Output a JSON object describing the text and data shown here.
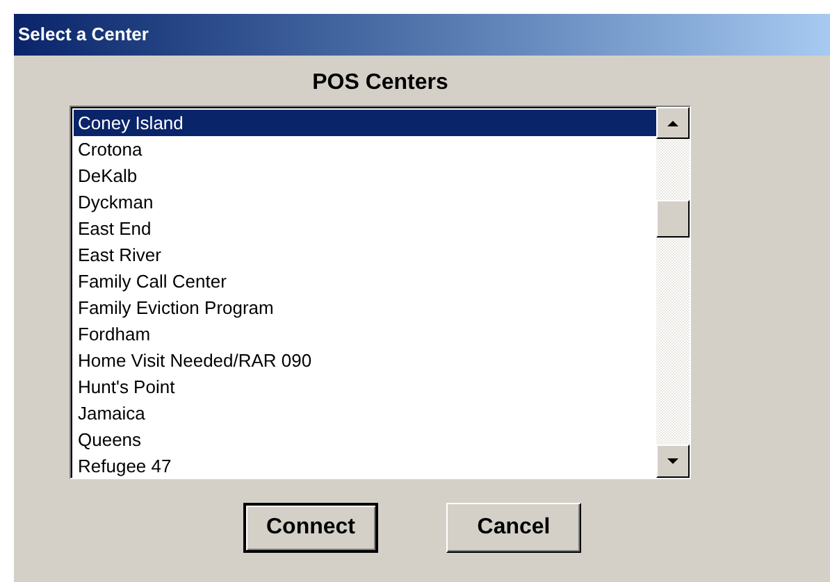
{
  "window": {
    "title": "Select a Center"
  },
  "list": {
    "heading": "POS Centers",
    "items": [
      {
        "label": "Coney Island",
        "selected": true
      },
      {
        "label": "Crotona",
        "selected": false
      },
      {
        "label": "DeKalb",
        "selected": false
      },
      {
        "label": "Dyckman",
        "selected": false
      },
      {
        "label": "East End",
        "selected": false
      },
      {
        "label": "East River",
        "selected": false
      },
      {
        "label": "Family Call Center",
        "selected": false
      },
      {
        "label": "Family Eviction Program",
        "selected": false
      },
      {
        "label": "Fordham",
        "selected": false
      },
      {
        "label": "Home Visit Needed/RAR 090",
        "selected": false
      },
      {
        "label": "Hunt's Point",
        "selected": false
      },
      {
        "label": "Jamaica",
        "selected": false
      },
      {
        "label": "Queens",
        "selected": false
      },
      {
        "label": "Refugee 47",
        "selected": false
      }
    ]
  },
  "buttons": [
    {
      "label": "Connect",
      "default": true
    },
    {
      "label": "Cancel",
      "default": false
    }
  ]
}
